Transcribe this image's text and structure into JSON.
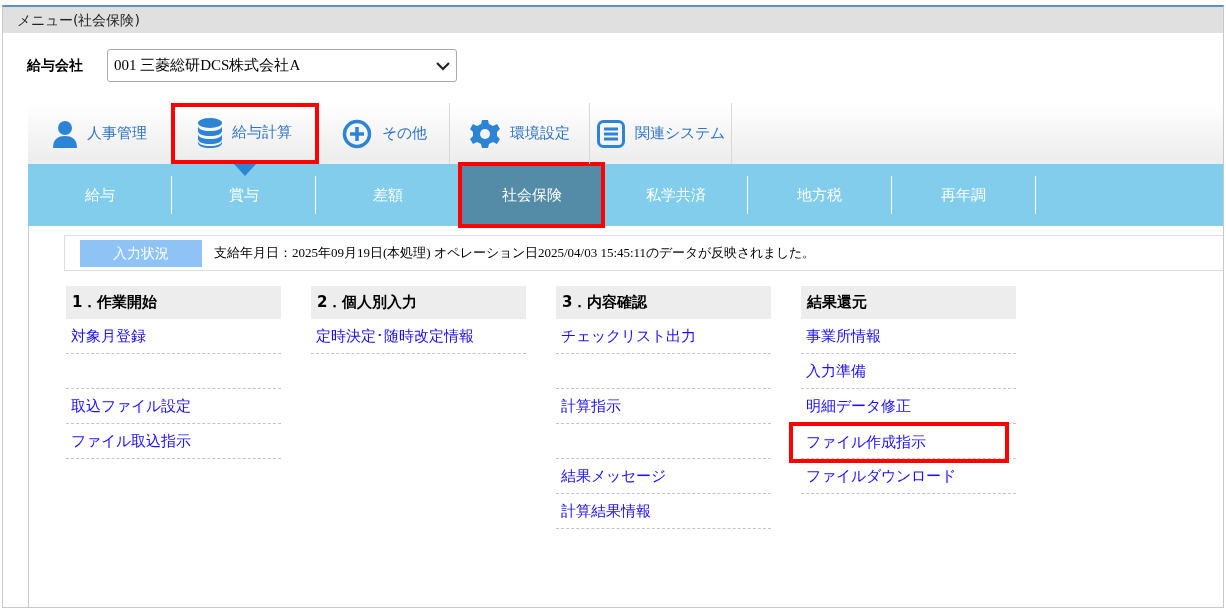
{
  "window": {
    "title": "メニュー(社会保険)"
  },
  "company": {
    "label": "給与会社",
    "value": "001 三菱総研DCS株式会社A"
  },
  "menu": [
    {
      "label": "人事管理",
      "selected": false,
      "highlighted": false
    },
    {
      "label": "給与計算",
      "selected": true,
      "highlighted": true
    },
    {
      "label": "その他",
      "selected": false,
      "highlighted": false
    },
    {
      "label": "環境設定",
      "selected": false,
      "highlighted": false
    },
    {
      "label": "関連システム",
      "selected": false,
      "highlighted": false
    }
  ],
  "subtabs": [
    {
      "label": "給与",
      "selected": false,
      "highlighted": false
    },
    {
      "label": "賞与",
      "selected": false,
      "highlighted": false
    },
    {
      "label": "差額",
      "selected": false,
      "highlighted": false
    },
    {
      "label": "社会保険",
      "selected": true,
      "highlighted": true
    },
    {
      "label": "私学共済",
      "selected": false,
      "highlighted": false
    },
    {
      "label": "地方税",
      "selected": false,
      "highlighted": false
    },
    {
      "label": "再年調",
      "selected": false,
      "highlighted": false
    }
  ],
  "status": {
    "badge": "入力状況",
    "text": "支給年月日：2025年09月19日(本処理) オペレーション日2025/04/03 15:45:11のデータが反映されました。"
  },
  "sections": [
    {
      "title": "1．作業開始",
      "items": [
        {
          "kind": "link",
          "label": "対象月登録",
          "highlighted": false
        },
        {
          "kind": "blank"
        },
        {
          "kind": "link",
          "label": "取込ファイル設定",
          "highlighted": false
        },
        {
          "kind": "link",
          "label": "ファイル取込指示",
          "highlighted": false
        }
      ]
    },
    {
      "title": "2．個人別入力",
      "items": [
        {
          "kind": "link",
          "label": "定時決定･随時改定情報",
          "highlighted": false
        }
      ]
    },
    {
      "title": "3．内容確認",
      "items": [
        {
          "kind": "link",
          "label": "チェックリスト出力",
          "highlighted": false
        },
        {
          "kind": "blank"
        },
        {
          "kind": "link",
          "label": "計算指示",
          "highlighted": false
        },
        {
          "kind": "blank"
        },
        {
          "kind": "link",
          "label": "結果メッセージ",
          "highlighted": false
        },
        {
          "kind": "link",
          "label": "計算結果情報",
          "highlighted": false
        }
      ]
    },
    {
      "title": "結果還元",
      "items": [
        {
          "kind": "link",
          "label": "事業所情報",
          "highlighted": false
        },
        {
          "kind": "link",
          "label": "入力準備",
          "highlighted": false
        },
        {
          "kind": "link",
          "label": "明細データ修正",
          "highlighted": false
        },
        {
          "kind": "link",
          "label": "ファイル作成指示",
          "highlighted": true
        },
        {
          "kind": "link",
          "label": "ファイルダウンロード",
          "highlighted": false
        }
      ]
    }
  ]
}
